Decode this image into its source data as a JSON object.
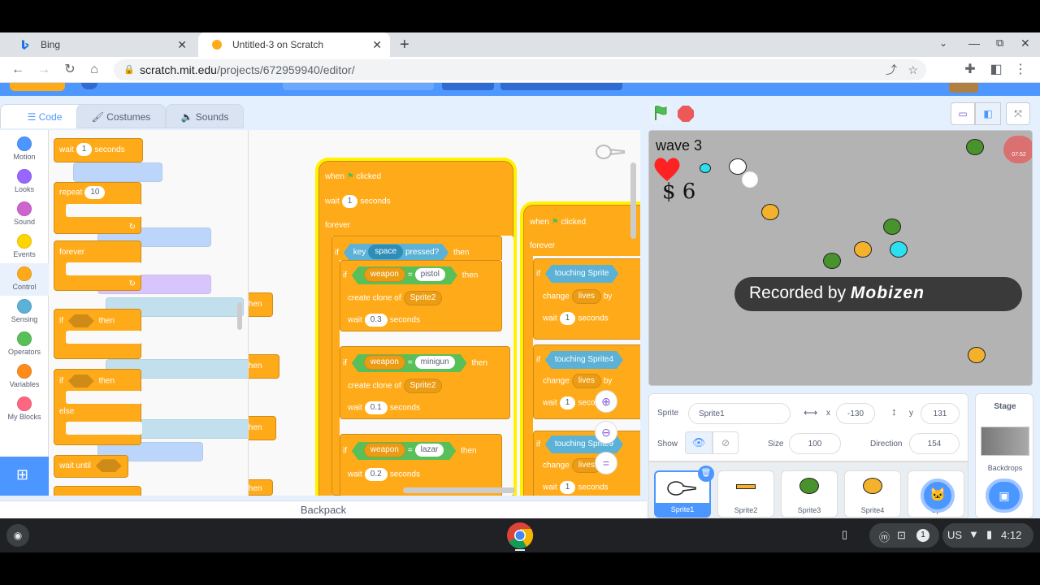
{
  "browser": {
    "tabs": [
      {
        "title": "Bing"
      },
      {
        "title": "Untitled-3 on Scratch"
      }
    ],
    "url_domain": "scratch.mit.edu",
    "url_path": "/projects/672959940/editor/"
  },
  "editor": {
    "tabs": {
      "code": "Code",
      "costumes": "Costumes",
      "sounds": "Sounds"
    },
    "categories": [
      {
        "label": "Motion",
        "color": "#4c97ff"
      },
      {
        "label": "Looks",
        "color": "#9966ff"
      },
      {
        "label": "Sound",
        "color": "#cf63cf"
      },
      {
        "label": "Events",
        "color": "#ffd500"
      },
      {
        "label": "Control",
        "color": "#ffab19"
      },
      {
        "label": "Sensing",
        "color": "#5cb1d6"
      },
      {
        "label": "Operators",
        "color": "#59c059"
      },
      {
        "label": "Variables",
        "color": "#ff8c1a"
      },
      {
        "label": "My Blocks",
        "color": "#ff6680"
      }
    ],
    "palette": {
      "wait": "wait",
      "wait_val": "1",
      "seconds": "seconds",
      "repeat": "repeat",
      "repeat_val": "10",
      "forever": "forever",
      "if": "if",
      "then": "then",
      "else": "else",
      "wait_until": "wait until"
    },
    "script1": {
      "hat_when": "when",
      "hat_clicked": "clicked",
      "wait": "wait",
      "wait_val": "1",
      "seconds": "seconds",
      "forever": "forever",
      "if": "if",
      "key": "key",
      "key_opt": "space",
      "pressed": "pressed?",
      "then": "then",
      "weapon_var": "weapon",
      "eq": "=",
      "pistol": "pistol",
      "create_clone": "create clone of",
      "sprite2": "Sprite2",
      "wait_03": "0.3",
      "minigun": "minigun",
      "wait_01": "0.1",
      "lazar": "lazar",
      "wait_02": "0.2"
    },
    "script2": {
      "hat_when": "when",
      "hat_clicked": "clicked",
      "forever": "forever",
      "if": "if",
      "touching": "touching",
      "sprite_a": "Sprite",
      "change": "change",
      "lives": "lives",
      "by": "by",
      "wait": "wait",
      "wait_val": "1",
      "seconds": "seconds",
      "sprite4": "Sprite4",
      "sprite9": "Sprite9"
    },
    "backpack": "Backpack"
  },
  "stage": {
    "wave_text": "wave 3",
    "money_text": "$ 6",
    "recorded_text": "Recorded by",
    "recorder_brand": "Mobizen",
    "timer_text": "07:52"
  },
  "sprite_info": {
    "sprite_label": "Sprite",
    "sprite_name": "Sprite1",
    "x_label": "x",
    "x_value": "-130",
    "y_label": "y",
    "y_value": "131",
    "show_label": "Show",
    "size_label": "Size",
    "size_value": "100",
    "direction_label": "Direction",
    "direction_value": "154"
  },
  "sprites": [
    {
      "name": "Sprite1"
    },
    {
      "name": "Sprite2"
    },
    {
      "name": "Sprite3"
    },
    {
      "name": "Sprite4"
    },
    {
      "name": "Sp"
    }
  ],
  "stage_selector": {
    "title": "Stage",
    "backdrops": "Backdrops"
  },
  "shelf": {
    "locale": "US",
    "time": "4:12",
    "notif_count": "1"
  }
}
